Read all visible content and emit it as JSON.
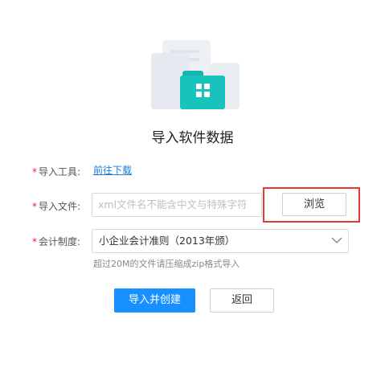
{
  "page": {
    "title": "导入软件数据"
  },
  "form": {
    "tool": {
      "required_mark": "*",
      "label": "导入工具:",
      "link_text": "前往下载"
    },
    "file": {
      "required_mark": "*",
      "label": "导入文件:",
      "placeholder": "xml文件名不能含中文与特殊字符",
      "browse_label": "浏览"
    },
    "accounting": {
      "required_mark": "*",
      "label": "会计制度:",
      "selected": "小企业会计准则（2013年颁）",
      "hint": "超过20M的文件请压缩成zip格式导入"
    }
  },
  "actions": {
    "primary_label": "导入并创建",
    "back_label": "返回"
  },
  "colors": {
    "accent": "#1890ff",
    "link": "#1a7bd6",
    "folder": "#19c3bd",
    "highlight": "#e53935",
    "required": "#f5222d"
  },
  "icons": {
    "illustration": "folder-documents-illustration",
    "select_arrow": "chevron-down-icon"
  }
}
